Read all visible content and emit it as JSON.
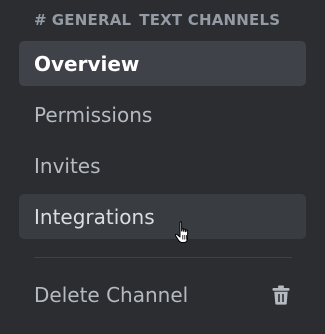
{
  "header": {
    "hash_icon": "#",
    "channel_name": "GENERAL",
    "category_label": "TEXT CHANNELS"
  },
  "menu": {
    "items": [
      {
        "label": "Overview",
        "state": "selected"
      },
      {
        "label": "Permissions",
        "state": "default"
      },
      {
        "label": "Invites",
        "state": "default"
      },
      {
        "label": "Integrations",
        "state": "hover"
      }
    ],
    "delete_label": "Delete Channel",
    "delete_icon": "trash-icon"
  },
  "colors": {
    "background": "#2b2d31",
    "selected_bg": "#404249",
    "hover_bg": "#393c41",
    "text_muted": "#b5bac1",
    "header_text": "#949ba4"
  }
}
